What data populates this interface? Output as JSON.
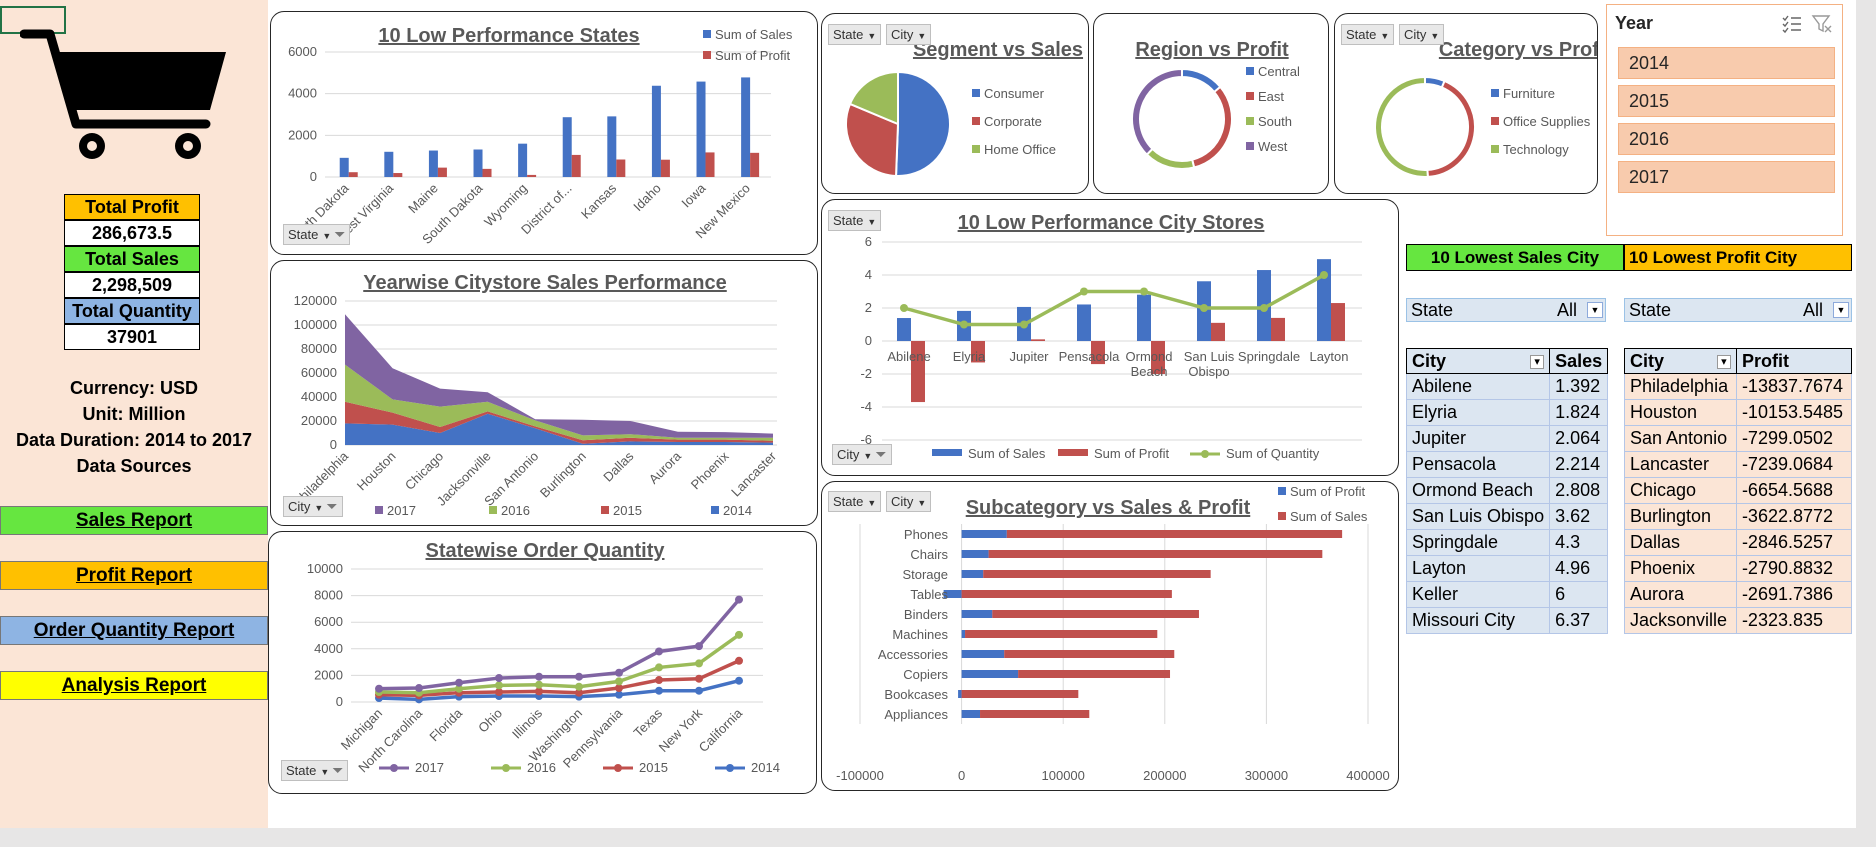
{
  "left_panel": {
    "kpis": [
      {
        "label": "Total Profit",
        "value": "286,673.5",
        "color": "#ffc000"
      },
      {
        "label": "Total Sales",
        "value": "2,298,509",
        "color": "#66e640"
      },
      {
        "label": "Total Quantity",
        "value": "37901",
        "color": "#8eb4e3"
      }
    ],
    "info": [
      "Currency: USD",
      "Unit: Million",
      "Data Duration: 2014 to 2017",
      "Data Sources"
    ],
    "nav": [
      {
        "label": "Sales Report",
        "color": "#66e640"
      },
      {
        "label": "Profit Report",
        "color": "#ffc000"
      },
      {
        "label": "Order Quantity Report",
        "color": "#8eb4e3"
      },
      {
        "label": "Analysis Report",
        "color": "#ffff00"
      }
    ]
  },
  "filters": {
    "state": "State",
    "city": "City"
  },
  "colors": {
    "blue": "#4472c4",
    "red": "#c0504d",
    "green": "#9bbb59",
    "purple": "#8064a2",
    "grid": "#d9d9d9"
  },
  "chart_data": [
    {
      "id": "low_states",
      "type": "bar",
      "title": "10 Low Performance States",
      "categories": [
        "North Dakota",
        "West Virginia",
        "Maine",
        "South Dakota",
        "Wyoming",
        "District of...",
        "Kansas",
        "Idaho",
        "Iowa",
        "New Mexico"
      ],
      "series": [
        {
          "name": "Sum of Sales",
          "values": [
            920,
            1210,
            1270,
            1320,
            1600,
            2870,
            2910,
            4380,
            4580,
            4780
          ]
        },
        {
          "name": "Sum of Profit",
          "values": [
            230,
            190,
            450,
            390,
            100,
            1060,
            840,
            830,
            1180,
            1160
          ]
        }
      ],
      "yticks": [
        "0",
        "2000",
        "4000",
        "6000"
      ],
      "ylim": [
        0,
        6000
      ],
      "legend": "top-right",
      "grid": true
    },
    {
      "id": "segment_sales",
      "type": "pie",
      "title": "Segment vs Sales",
      "labels": [
        "Consumer",
        "Corporate",
        "Home Office"
      ],
      "values": [
        50.6,
        30.7,
        18.7
      ],
      "legend": "right"
    },
    {
      "id": "region_profit",
      "type": "pie",
      "title": "Region vs Profit",
      "labels": [
        "Central",
        "East",
        "South",
        "West"
      ],
      "values": [
        13.9,
        32.2,
        16.3,
        37.6
      ],
      "legend": "right"
    },
    {
      "id": "category_profit",
      "type": "pie",
      "title": "Category vs Profit",
      "labels": [
        "Furniture",
        "Office Supplies",
        "Technology"
      ],
      "values": [
        6.4,
        42.7,
        50.9
      ],
      "legend": "right"
    },
    {
      "id": "yearwise_city",
      "type": "area",
      "title": "Yearwise Citystore Sales Performance",
      "categories": [
        "Philadelphia",
        "Houston",
        "Chicago",
        "Jacksonville",
        "San Antonio",
        "Burlington",
        "Dallas",
        "Aurora",
        "Phoenix",
        "Lancaster"
      ],
      "series": [
        {
          "name": "2014",
          "values": [
            18000,
            17000,
            10000,
            26000,
            14000,
            1000,
            3000,
            2500,
            2500,
            2000
          ]
        },
        {
          "name": "2015",
          "values": [
            18000,
            10000,
            5000,
            2000,
            1500,
            3000,
            3000,
            2000,
            2000,
            1500
          ]
        },
        {
          "name": "2016",
          "values": [
            31000,
            11000,
            17000,
            8000,
            5000,
            4000,
            3000,
            1500,
            1500,
            2500
          ]
        },
        {
          "name": "2017",
          "values": [
            42000,
            26000,
            15000,
            8000,
            1000,
            13000,
            11000,
            5000,
            4700,
            3500
          ]
        }
      ],
      "yticks": [
        "0",
        "20000",
        "40000",
        "60000",
        "80000",
        "100000",
        "120000"
      ],
      "ylim": [
        0,
        120000
      ],
      "legend": "bottom",
      "grid": true
    },
    {
      "id": "statewise_qty",
      "type": "line",
      "title": "Statewise Order Quantity",
      "categories": [
        "Michigan",
        "North Carolina",
        "Florida",
        "Ohio",
        "Illinois",
        "Washington",
        "Pennsylvania",
        "Texas",
        "New York",
        "California"
      ],
      "series": [
        {
          "name": "2017",
          "values": [
            1000,
            1050,
            1450,
            1800,
            1900,
            1900,
            2200,
            3800,
            4200,
            7700
          ]
        },
        {
          "name": "2016",
          "values": [
            750,
            700,
            1000,
            1250,
            1300,
            1150,
            1550,
            2600,
            2900,
            5050
          ]
        },
        {
          "name": "2015",
          "values": [
            550,
            500,
            700,
            750,
            800,
            700,
            1050,
            1650,
            1750,
            3100
          ]
        },
        {
          "name": "2014",
          "values": [
            300,
            200,
            400,
            450,
            450,
            400,
            550,
            850,
            850,
            1600
          ]
        }
      ],
      "yticks": [
        "0",
        "2000",
        "4000",
        "6000",
        "8000",
        "10000"
      ],
      "ylim": [
        0,
        10000
      ],
      "legend": "bottom",
      "grid": true
    },
    {
      "id": "low_city",
      "type": "bar",
      "title": "10 Low Performance City Stores",
      "categories": [
        "Abilene",
        "Elyria",
        "Jupiter",
        "Pensacola",
        "Ormond Beach",
        "San Luis Obispo",
        "Springdale",
        "Layton"
      ],
      "series": [
        {
          "name": "Sum of Sales",
          "values": [
            1.392,
            1.824,
            2.064,
            2.214,
            2.808,
            3.62,
            4.3,
            4.96
          ]
        },
        {
          "name": "Sum of Profit",
          "values": [
            -3.7,
            -1.3,
            0.1,
            -1.4,
            -2.0,
            1.1,
            1.4,
            2.3
          ]
        },
        {
          "name": "Sum of Quantity",
          "values": [
            2,
            1,
            1,
            3,
            3,
            2,
            2,
            4
          ]
        }
      ],
      "yticks": [
        "-6",
        "-4",
        "-2",
        "0",
        "2",
        "4",
        "6"
      ],
      "ylim": [
        -6,
        6
      ],
      "legend": "bottom",
      "grid": true
    },
    {
      "id": "subcategory",
      "type": "bar",
      "title": "Subcategory vs Sales & Profit",
      "categories": [
        "Phones",
        "Chairs",
        "Storage",
        "Tables",
        "Binders",
        "Machines",
        "Accessories",
        "Copiers",
        "Bookcases",
        "Appliances"
      ],
      "series": [
        {
          "name": "Sum of Profit",
          "values": [
            44516,
            26590,
            21279,
            -17725,
            30222,
            3385,
            41937,
            55618,
            -3473,
            18138
          ]
        },
        {
          "name": "Sum of Sales",
          "values": [
            330007,
            328449,
            223844,
            206966,
            203413,
            189239,
            167380,
            149528,
            114880,
            107532
          ]
        }
      ],
      "xticks": [
        "-100000",
        "0",
        "100000",
        "200000",
        "300000",
        "400000"
      ],
      "xlim": [
        -100000,
        400000
      ],
      "legend": "top-right",
      "grid": true
    }
  ],
  "slicer": {
    "title": "Year",
    "items": [
      "2014",
      "2015",
      "2016",
      "2017"
    ]
  },
  "low_sales": {
    "title": "10 Lowest Sales City",
    "filter_label": "State",
    "filter_value": "All",
    "col1": "City",
    "col2": "Sales",
    "rows": [
      [
        "Abilene",
        "1.392"
      ],
      [
        "Elyria",
        "1.824"
      ],
      [
        "Jupiter",
        "2.064"
      ],
      [
        "Pensacola",
        "2.214"
      ],
      [
        "Ormond Beach",
        "2.808"
      ],
      [
        "San Luis Obispo",
        "3.62"
      ],
      [
        "Springdale",
        "4.3"
      ],
      [
        "Layton",
        "4.96"
      ],
      [
        "Keller",
        "6"
      ],
      [
        "Missouri City",
        "6.37"
      ]
    ]
  },
  "low_profit": {
    "title": "10 Lowest Profit City",
    "filter_label": "State",
    "filter_value": "All",
    "col1": "City",
    "col2": "Profit",
    "rows": [
      [
        "Philadelphia",
        "-13837.7674"
      ],
      [
        "Houston",
        "-10153.5485"
      ],
      [
        "San Antonio",
        "-7299.0502"
      ],
      [
        "Lancaster",
        "-7239.0684"
      ],
      [
        "Chicago",
        "-6654.5688"
      ],
      [
        "Burlington",
        "-3622.8772"
      ],
      [
        "Dallas",
        "-2846.5257"
      ],
      [
        "Phoenix",
        "-2790.8832"
      ],
      [
        "Aurora",
        "-2691.7386"
      ],
      [
        "Jacksonville",
        "-2323.835"
      ]
    ]
  }
}
